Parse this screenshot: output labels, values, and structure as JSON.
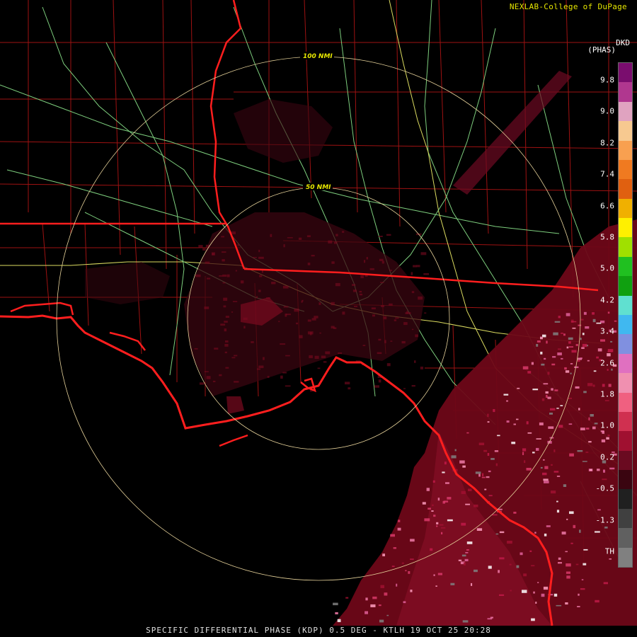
{
  "header": {
    "credit": "NEXLAB-College of DuPage",
    "units_code": "DKD",
    "units_name": "(PHAS)"
  },
  "range_rings": [
    {
      "label": "50 NMI"
    },
    {
      "label": "100 NMI"
    }
  ],
  "legend": {
    "ticks": [
      "9.8",
      "9.0",
      "8.2",
      "7.4",
      "6.6",
      "5.8",
      "5.0",
      "4.2",
      "3.4",
      "2.6",
      "1.8",
      "1.0",
      "0.2",
      "-0.5",
      "-1.3",
      "TH"
    ],
    "colors": [
      "#7a0d6e",
      "#b0378f",
      "#e0a3c0",
      "#f7c990",
      "#f8a050",
      "#f07a20",
      "#e06010",
      "#f0b000",
      "#fff000",
      "#a0e000",
      "#20c020",
      "#10a010",
      "#60e0d0",
      "#40b8f0",
      "#8090e0",
      "#e070c0",
      "#f090b0",
      "#f06080",
      "#d03050",
      "#a01030",
      "#6a0a20",
      "#3a0510",
      "#202020",
      "#404040",
      "#606060",
      "#808080"
    ]
  },
  "footer": {
    "product": "SPECIFIC DIFFERENTIAL PHASE (KDP) 0.5 DEG - KTLH 19 OCT 25 20:28"
  }
}
